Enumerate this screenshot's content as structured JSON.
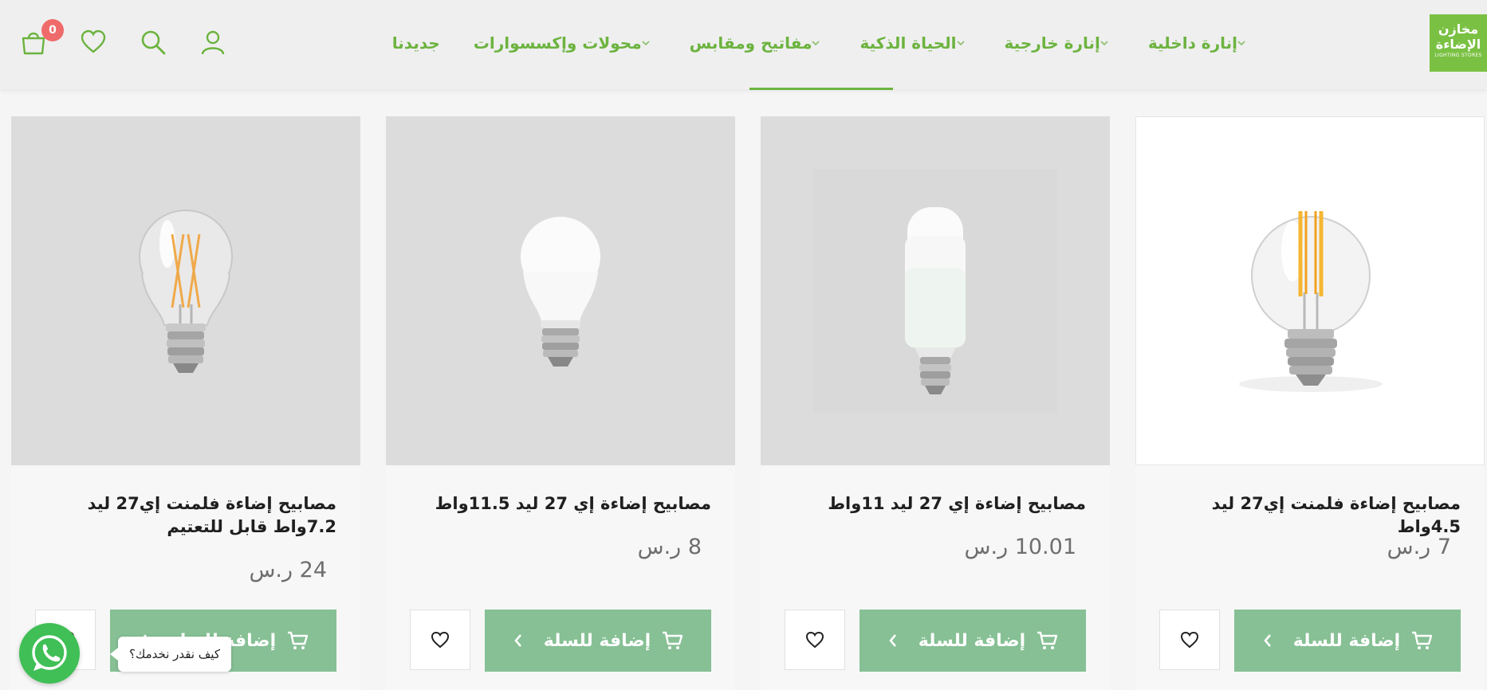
{
  "logo": {
    "line1": "مخازن",
    "line2": "الإضاءة",
    "line3": "LIGHTING STORES"
  },
  "nav": [
    {
      "label": "إنارة داخلية",
      "dropdown": true
    },
    {
      "label": "إنارة خارجية",
      "dropdown": true
    },
    {
      "label": "الحياة الذكية",
      "dropdown": true
    },
    {
      "label": "مفاتيح ومقابس",
      "dropdown": true
    },
    {
      "label": "محولات وإكسسوارات",
      "dropdown": true
    },
    {
      "label": "جديدنا",
      "dropdown": false
    }
  ],
  "header_icons": [
    "user-icon",
    "search-icon",
    "heart-icon",
    "cart-icon"
  ],
  "cart_count": "0",
  "colors": {
    "accent": "#6cb33f",
    "button": "#86c094",
    "badge": "#ef6a6a",
    "whatsapp": "#3fbf55"
  },
  "products": [
    {
      "title": "مصابيح إضاءة فلمنت إي27 ليد 4.5واط",
      "price": "7 ر.س",
      "image": "filament-globe-bulb",
      "add_label": "إضافة للسلة"
    },
    {
      "title": "مصابيح إضاءة إي 27 ليد 11واط",
      "price": "10.01 ر.س",
      "image": "tubular-led-bulb",
      "add_label": "إضافة للسلة"
    },
    {
      "title": "مصابيح إضاءة إي 27 ليد 11.5واط",
      "price": "8 ر.س",
      "image": "frosted-a60-bulb",
      "add_label": "إضافة للسلة"
    },
    {
      "title": "مصابيح إضاءة فلمنت إي27 ليد 7.2واط قابل للتعتيم",
      "price": "24 ر.س",
      "image": "filament-a60-bulb",
      "add_label": "إضافة للسلة"
    }
  ],
  "whatsapp": {
    "bubble": "كيف نقدر نخدمك؟"
  }
}
